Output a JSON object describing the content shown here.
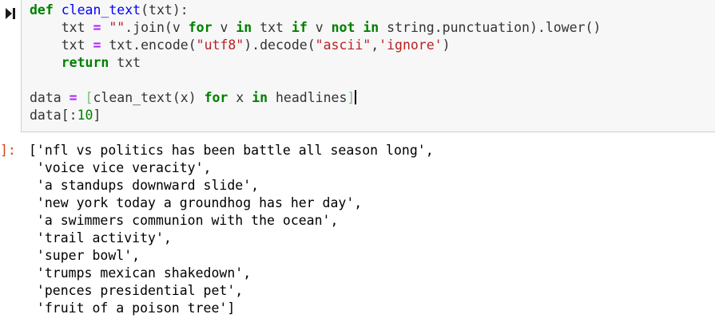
{
  "input": {
    "lines": [
      [
        {
          "t": "def",
          "c": "kw"
        },
        {
          "t": " ",
          "c": ""
        },
        {
          "t": "clean_text",
          "c": "fn"
        },
        {
          "t": "(txt):",
          "c": ""
        }
      ],
      [
        {
          "t": "    txt ",
          "c": ""
        },
        {
          "t": "=",
          "c": "op"
        },
        {
          "t": " ",
          "c": ""
        },
        {
          "t": "\"\"",
          "c": "str"
        },
        {
          "t": ".join(v ",
          "c": ""
        },
        {
          "t": "for",
          "c": "kw"
        },
        {
          "t": " v ",
          "c": ""
        },
        {
          "t": "in",
          "c": "kw"
        },
        {
          "t": " txt ",
          "c": ""
        },
        {
          "t": "if",
          "c": "kw"
        },
        {
          "t": " v ",
          "c": ""
        },
        {
          "t": "not",
          "c": "kw"
        },
        {
          "t": " ",
          "c": ""
        },
        {
          "t": "in",
          "c": "kw"
        },
        {
          "t": " string.punctuation).lower()",
          "c": ""
        }
      ],
      [
        {
          "t": "    txt ",
          "c": ""
        },
        {
          "t": "=",
          "c": "op"
        },
        {
          "t": " txt.encode(",
          "c": ""
        },
        {
          "t": "\"utf8\"",
          "c": "str"
        },
        {
          "t": ").decode(",
          "c": ""
        },
        {
          "t": "\"ascii\"",
          "c": "str"
        },
        {
          "t": ",",
          "c": ""
        },
        {
          "t": "'ignore'",
          "c": "str"
        },
        {
          "t": ")",
          "c": ""
        }
      ],
      [
        {
          "t": "    ",
          "c": ""
        },
        {
          "t": "return",
          "c": "kw"
        },
        {
          "t": " txt",
          "c": ""
        }
      ],
      [],
      [
        {
          "t": "data ",
          "c": ""
        },
        {
          "t": "=",
          "c": "op"
        },
        {
          "t": " ",
          "c": ""
        },
        {
          "t": "[",
          "c": "br"
        },
        {
          "t": "clean_text(x) ",
          "c": ""
        },
        {
          "t": "for",
          "c": "kw"
        },
        {
          "t": " x ",
          "c": ""
        },
        {
          "t": "in",
          "c": "kw"
        },
        {
          "t": " headlines",
          "c": ""
        },
        {
          "t": "]",
          "c": "br"
        },
        {
          "t": "",
          "c": "cursor"
        }
      ],
      [
        {
          "t": "data[:",
          "c": ""
        },
        {
          "t": "10",
          "c": "num"
        },
        {
          "t": "]",
          "c": ""
        }
      ]
    ]
  },
  "output": {
    "prompt": "]:",
    "lines": [
      "['nfl vs politics has been battle all season long',",
      " 'voice vice veracity',",
      " 'a standups downward slide',",
      " 'new york today a groundhog has her day',",
      " 'a swimmers communion with the ocean',",
      " 'trail activity',",
      " 'super bowl',",
      " 'trumps mexican shakedown',",
      " 'pences presidential pet',",
      " 'fruit of a poison tree']"
    ]
  },
  "colors": {
    "keyword": "#008000",
    "function": "#0000ff",
    "string": "#ba2121",
    "operator": "#aa22ff",
    "prompt": "#d84315",
    "cell_background": "#f7f7f7"
  }
}
